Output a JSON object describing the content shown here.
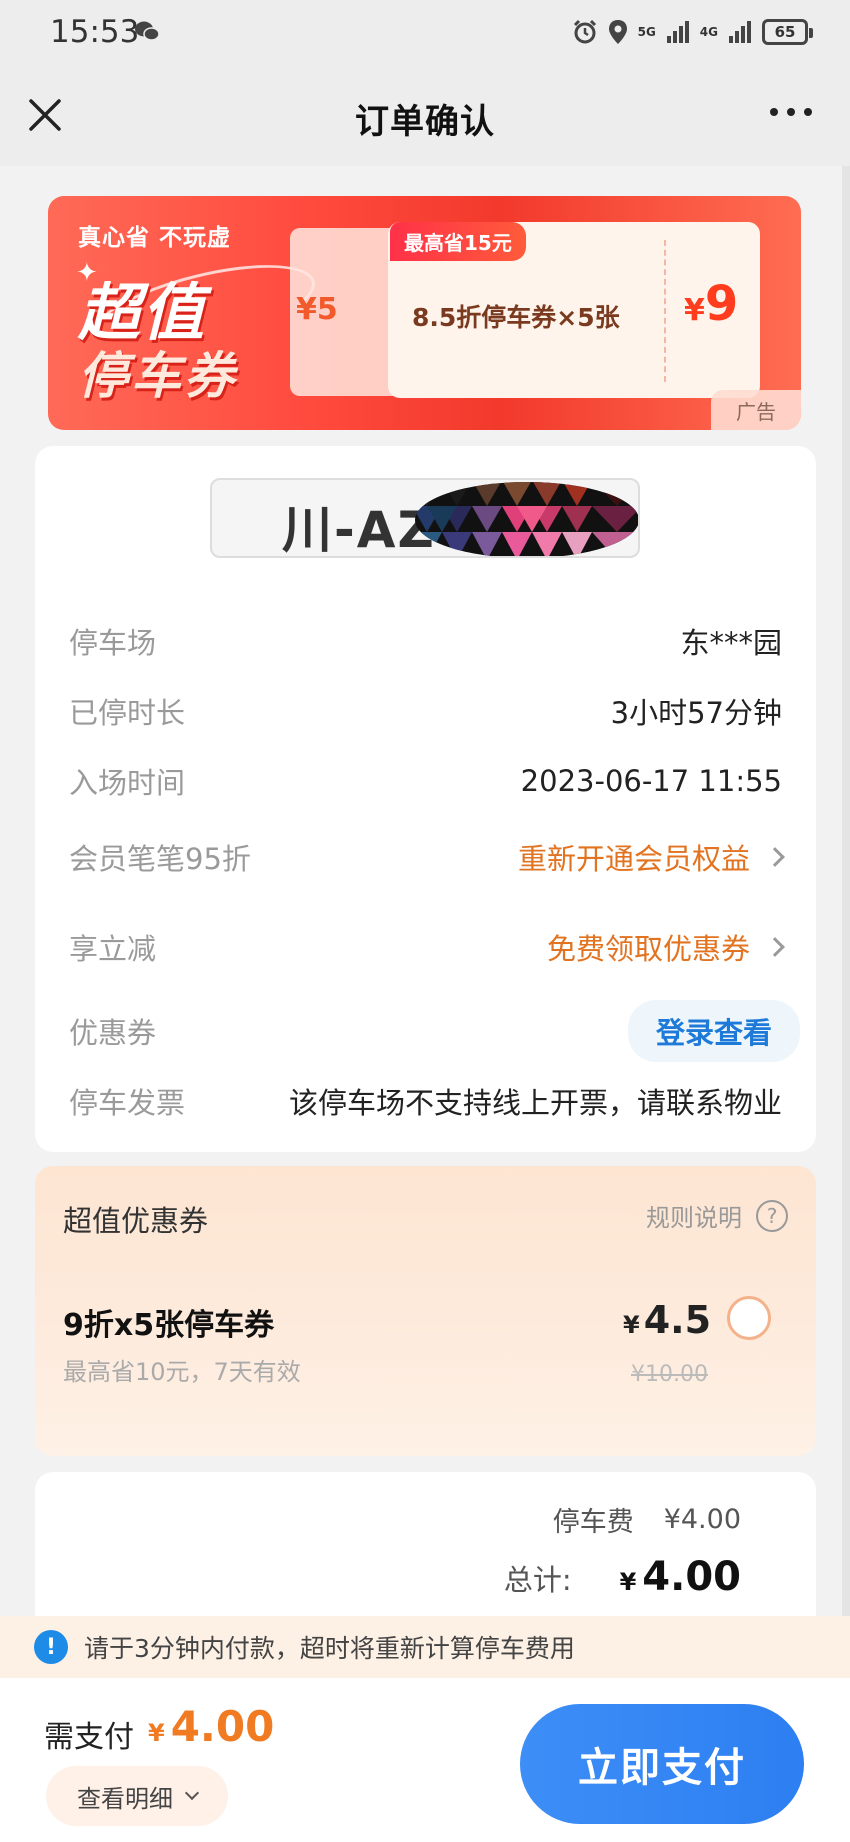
{
  "status_bar": {
    "time": "15:53",
    "signal_1": "5G",
    "signal_2": "4G",
    "battery": "65"
  },
  "header": {
    "title": "订单确认",
    "close_icon": "close-icon",
    "more_icon": "more-icon"
  },
  "banner": {
    "slogan": "真心省  不玩虚",
    "big_text_1": "超值",
    "big_text_2": "停车券",
    "back_ticket_text": "¥5",
    "tag": "最高省15元",
    "desc": "8.5折停车券×5张",
    "price_symbol": "¥",
    "price": "9",
    "ad_label": "广告"
  },
  "order": {
    "plate": "川-AZ",
    "rows": [
      {
        "label": "停车场",
        "value": "东***园"
      },
      {
        "label": "已停时长",
        "value": "3小时57分钟"
      },
      {
        "label": "入场时间",
        "value": "2023-06-17 11:55"
      },
      {
        "label": "会员笔笔95折",
        "value": "重新开通会员权益"
      },
      {
        "label": "享立减",
        "value": "免费领取优惠券"
      },
      {
        "label": "优惠券",
        "value": "登录查看"
      },
      {
        "label": "停车发票",
        "value": "该停车场不支持线上开票，请联系物业"
      }
    ]
  },
  "coupon": {
    "title": "超值优惠券",
    "rule_label": "规则说明",
    "name": "9折x5张停车券",
    "sub": "最高省10元，7天有效",
    "price_symbol": "¥",
    "price": "4.5",
    "original_price": "¥10.00"
  },
  "fees": {
    "parking_fee_label": "停车费",
    "parking_fee_value": "¥4.00",
    "total_label": "总计:",
    "total_symbol": "¥",
    "total_value": "4.00"
  },
  "notice": {
    "text": "请于3分钟内付款，超时将重新计算停车费用"
  },
  "footer": {
    "pay_label": "需支付",
    "pay_symbol": "¥",
    "pay_amount": "4.00",
    "detail_button": "查看明细",
    "pay_button": "立即支付"
  },
  "colors": {
    "accent_orange": "#e27320",
    "primary_blue": "#2d7ff2",
    "banner_red": "#f2392c"
  }
}
